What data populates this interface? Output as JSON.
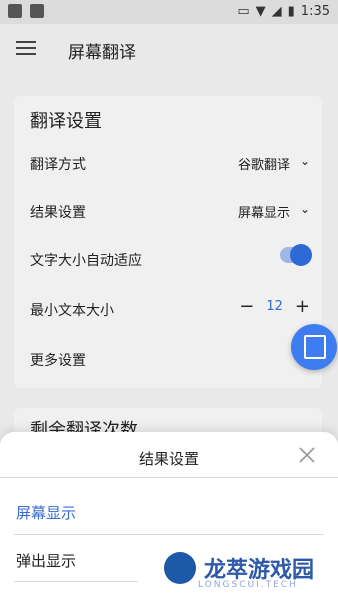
{
  "status": {
    "time": "1:35"
  },
  "appbar": {
    "title": "屏幕翻译"
  },
  "translate_settings": {
    "header": "翻译设置",
    "rows": [
      {
        "label": "翻译方式",
        "value": "谷歌翻译"
      },
      {
        "label": "结果设置",
        "value": "屏幕显示"
      },
      {
        "label": "文字大小自动适应",
        "toggle_on": true
      },
      {
        "label": "最小文本大小",
        "stepper_value": "12"
      },
      {
        "label": "更多设置"
      }
    ]
  },
  "remaining": {
    "header": "剩余翻译次数"
  },
  "sheet": {
    "title": "结果设置",
    "options": [
      {
        "label": "屏幕显示",
        "selected": true
      },
      {
        "label": "弹出显示",
        "selected": false
      }
    ]
  },
  "watermark": {
    "brand": "龙萃游戏园",
    "sub": "LONGSCUI.TECH"
  },
  "colors": {
    "accent": "#3a6ccf",
    "fab": "#3d7df0"
  }
}
